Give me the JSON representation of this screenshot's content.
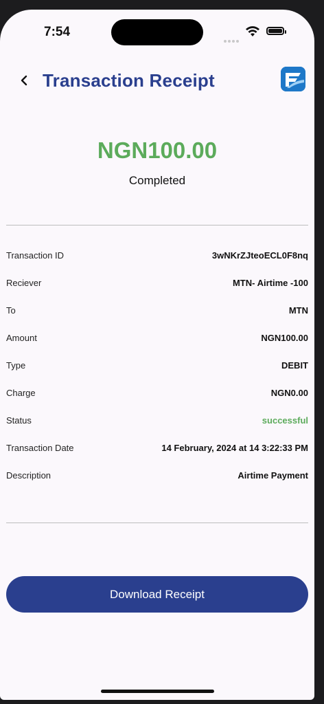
{
  "status_bar": {
    "time": "7:54"
  },
  "header": {
    "title": "Transaction Receipt"
  },
  "summary": {
    "amount": "NGN100.00",
    "state": "Completed"
  },
  "details": [
    {
      "label": "Transaction ID",
      "value": "3wNKrZJteoECL0F8nq"
    },
    {
      "label": "Reciever",
      "value": "MTN- Airtime -100"
    },
    {
      "label": "To",
      "value": "MTN"
    },
    {
      "label": "Amount",
      "value": "NGN100.00"
    },
    {
      "label": "Type",
      "value": "DEBIT"
    },
    {
      "label": "Charge",
      "value": "NGN0.00"
    },
    {
      "label": "Status",
      "value": "successful"
    },
    {
      "label": "Transaction Date",
      "value": "14 February, 2024 at 14 3:22:33 PM"
    },
    {
      "label": "Description",
      "value": "Airtime Payment"
    }
  ],
  "actions": {
    "download_label": "Download Receipt"
  },
  "colors": {
    "primary": "#2a3f8e",
    "success": "#5cab5b",
    "background": "#fbf8fc"
  },
  "icons": {
    "back": "chevron-left-icon",
    "logo": "app-logo-icon"
  }
}
